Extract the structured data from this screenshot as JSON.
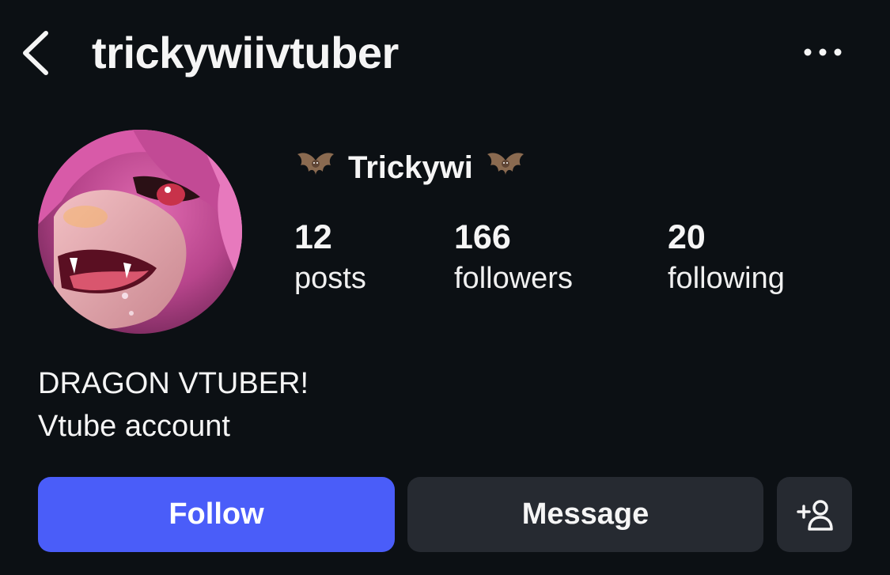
{
  "header": {
    "username": "trickywiivtuber",
    "back_icon": "chevron-left-icon",
    "more_icon": "more-horizontal-icon"
  },
  "profile": {
    "display_name": "Trickywi",
    "name_decoration_icon": "bat-emoji",
    "avatar": "pink-haired anime dragon character portrait"
  },
  "stats": {
    "posts": {
      "count": "12",
      "label": "posts"
    },
    "followers": {
      "count": "166",
      "label": "followers"
    },
    "following": {
      "count": "20",
      "label": "following"
    }
  },
  "bio": {
    "line1": "DRAGON VTUBER!",
    "line2": "Vtube account"
  },
  "actions": {
    "follow_label": "Follow",
    "message_label": "Message",
    "suggest_icon": "add-person-icon"
  },
  "colors": {
    "background": "#0c1014",
    "follow_button": "#4a5df9",
    "secondary_button": "#262a31",
    "text": "#f5f5f5"
  }
}
